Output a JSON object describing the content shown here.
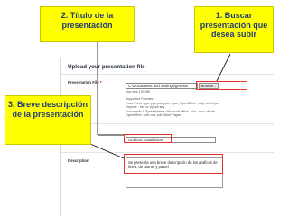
{
  "callouts": {
    "titulo": "2. Título de la presentación",
    "buscar": "1. Buscar presentación que desea subir",
    "breve": "3. Breve descripción de la presentación"
  },
  "form": {
    "heading": "Upload your presentation file",
    "file_label": "Presentation File",
    "required_mark": "*",
    "file_path": "C:\\Documents and Settings\\germos",
    "browse_label": "Browse...",
    "max_size": "Max size 100 MB.",
    "supported_title": "Supported Formats:",
    "formats": [
      "PowerPoint - ppt, pps, pot, pptx, ppsx, OpenOffice - odp, sxi, impre",
      "Keynote - key or zipped key",
      "Documents & Spreadsheets: Microsoft Office - doc, docx, rtf, xls,",
      "OpenOffice - odt, ods, pdf, Word Pages"
    ],
    "title_label": "Title",
    "title_value": "Graficos Estadisticos",
    "description_label": "Description",
    "description_value": "Se presenta una breve descripción de los graficos de línea, de barras y pastel"
  },
  "colors": {
    "callout_bg": "#ffff00",
    "callout_text": "#1f3a7a",
    "highlight": "#e8302a"
  }
}
